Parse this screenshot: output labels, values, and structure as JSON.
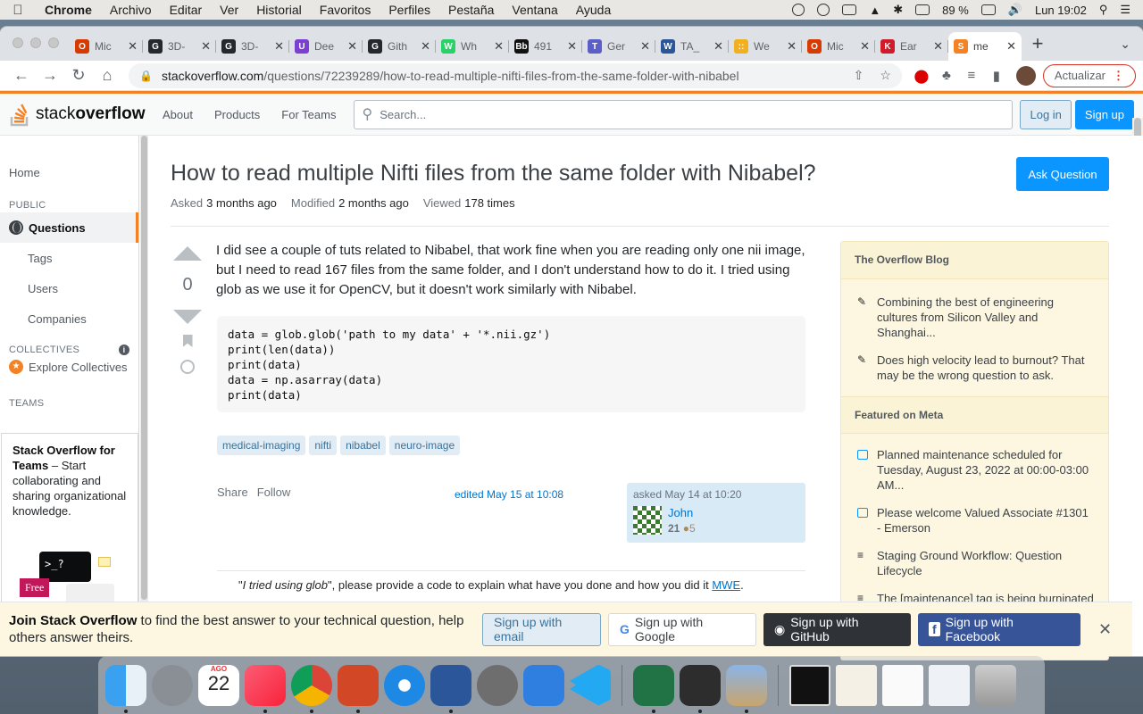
{
  "menubar": {
    "app": "Chrome",
    "items": [
      "Archivo",
      "Editar",
      "Ver",
      "Historial",
      "Favoritos",
      "Perfiles",
      "Pestaña",
      "Ventana",
      "Ayuda"
    ],
    "battery": "89 %",
    "clock": "Lun 19:02"
  },
  "tabs": [
    {
      "title": "Mic",
      "color": "#d83b01",
      "letter": "O"
    },
    {
      "title": "3D-",
      "color": "#24292f",
      "letter": "G"
    },
    {
      "title": "3D-",
      "color": "#24292f",
      "letter": "G"
    },
    {
      "title": "Dee",
      "color": "#7b3fd1",
      "letter": "U"
    },
    {
      "title": "Gith",
      "color": "#24292f",
      "letter": "G"
    },
    {
      "title": "Wh",
      "color": "#25d366",
      "letter": "W"
    },
    {
      "title": "491",
      "color": "#111111",
      "letter": "Bb"
    },
    {
      "title": "Ger",
      "color": "#5b5fc7",
      "letter": "T"
    },
    {
      "title": "TA_",
      "color": "#2b579a",
      "letter": "W"
    },
    {
      "title": "We",
      "color": "#f2b01e",
      "letter": "::"
    },
    {
      "title": "Mic",
      "color": "#d83b01",
      "letter": "O"
    },
    {
      "title": "Ear",
      "color": "#d11a2a",
      "letter": "K"
    },
    {
      "title": "me",
      "color": "#f48225",
      "letter": "S"
    }
  ],
  "address": {
    "domain": "stackoverflow.com",
    "path": "/questions/72239289/how-to-read-multiple-nifti-files-from-the-same-folder-with-nibabel"
  },
  "browser": {
    "update_label": "Actualizar"
  },
  "so_header": {
    "logo_stack": "stack",
    "logo_overflow": "overflow",
    "nav": [
      "About",
      "Products",
      "For Teams"
    ],
    "search_placeholder": "Search...",
    "login": "Log in",
    "signup": "Sign up"
  },
  "leftnav": {
    "home": "Home",
    "public_label": "PUBLIC",
    "questions": "Questions",
    "tags": "Tags",
    "users": "Users",
    "companies": "Companies",
    "collectives_label": "COLLECTIVES",
    "explore_collectives": "Explore Collectives",
    "teams_label": "TEAMS",
    "teams_title": "Stack Overflow for Teams",
    "teams_text": " – Start collaborating and sharing organizational knowledge.",
    "free_badge": "Free",
    "terminal_glyph": ">_?"
  },
  "question": {
    "title": "How to read multiple Nifti files from the same folder with Nibabel?",
    "ask_button": "Ask Question",
    "asked_label": "Asked",
    "asked_value": "3 months ago",
    "modified_label": "Modified",
    "modified_value": "2 months ago",
    "viewed_label": "Viewed",
    "viewed_value": "178 times",
    "score": "0",
    "body": "I did see a couple of tuts related to Nibabel, that work fine when you are reading only one nii image, but I need to read 167 files from the same folder, and I don't understand how to do it. I tried using glob as we use it for OpenCV, but it doesn't work similarly with Nibabel.",
    "code": "data = glob.glob('path to my data' + '*.nii.gz')\nprint(len(data))\nprint(data)\ndata = np.asarray(data)\nprint(data)",
    "tags": [
      "medical-imaging",
      "nifti",
      "nibabel",
      "neuro-image"
    ],
    "share": "Share",
    "follow": "Follow",
    "edited": "edited May 15 at 10:08",
    "asked_time": "asked May 14 at 10:20",
    "user_name": "John",
    "user_rep": "21",
    "user_bronze": "5",
    "comment_quote": "I tried using glob",
    "comment_text": ", please provide a code to explain what have you done and how you did it ",
    "comment_link": "MWE",
    "comment_end": "."
  },
  "sidebar": {
    "blog_title": "The Overflow Blog",
    "blog_items": [
      "Combining the best of engineering cultures from Silicon Valley and Shanghai...",
      "Does high velocity lead to burnout? That may be the wrong question to ask."
    ],
    "meta_title": "Featured on Meta",
    "meta_items": [
      {
        "text": "Planned maintenance scheduled for Tuesday, August 23, 2022 at 00:00-03:00 AM...",
        "icon": "bubble"
      },
      {
        "text": "Please welcome Valued Associate #1301 - Emerson",
        "icon": "bubble"
      },
      {
        "text": "Staging Ground Workflow: Question Lifecycle",
        "icon": "stack"
      },
      {
        "text": "The [maintenance] tag is being burninated",
        "icon": "stack"
      }
    ]
  },
  "banner": {
    "title": "Join Stack Overflow",
    "text": " to find the best answer to your technical question, help others answer theirs.",
    "email": "Sign up with email",
    "google": "Sign up with Google",
    "github": "Sign up with GitHub",
    "facebook": "Sign up with Facebook"
  },
  "dock": {
    "calendar_month": "AGO",
    "calendar_day": "22",
    "apps": [
      "finder",
      "launchpad",
      "calendar",
      "music",
      "chrome",
      "powerpoint",
      "safari",
      "word",
      "system-preferences",
      "xcode-instruments",
      "vscode",
      "excel",
      "terminal",
      "preview"
    ]
  }
}
